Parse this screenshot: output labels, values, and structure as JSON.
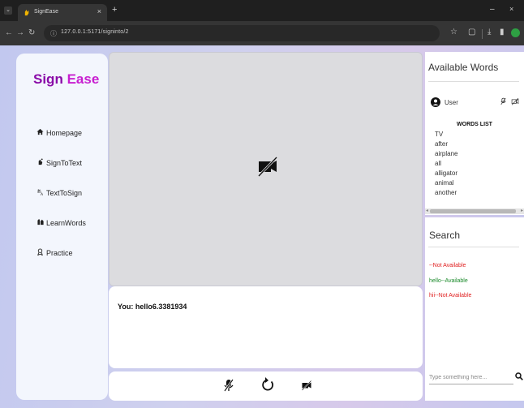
{
  "browser": {
    "tab_title": "SignEase",
    "url": "127.0.0.1:5171/signinto/2",
    "newtab_glyph": "+",
    "close_glyph": "×",
    "minimize_glyph": "–",
    "window_close_glyph": "×"
  },
  "app": {
    "logo_part1": "Sign",
    "logo_part2": " Ease",
    "brand_colors": [
      "#8a0ca8",
      "#c81fd0"
    ]
  },
  "nav": {
    "items": [
      {
        "label": "Homepage",
        "icon": "home-icon"
      },
      {
        "label": "SignToText",
        "icon": "hand-icon"
      },
      {
        "label": "TextToSign",
        "icon": "translate-icon"
      },
      {
        "label": "LearnWords",
        "icon": "sign-language-icon"
      },
      {
        "label": "Practice",
        "icon": "practice-icon"
      }
    ]
  },
  "transcript": {
    "label": "You:",
    "text": "hello6.3381934"
  },
  "words_panel": {
    "title": "Available Words",
    "user_name": "User",
    "list_title": "WORDS LIST",
    "words": [
      "TV",
      "after",
      "airplane",
      "all",
      "alligator",
      "animal",
      "another"
    ]
  },
  "search_panel": {
    "title": "Search",
    "results": [
      {
        "text": "--Not Available",
        "status": "not-available",
        "color": "#e02020"
      },
      {
        "text": "hello--Available",
        "status": "available",
        "color": "#1a8a2a"
      },
      {
        "text": "hii--Not Available",
        "status": "not-available",
        "color": "#e02020"
      }
    ],
    "placeholder": "Type something here..."
  }
}
